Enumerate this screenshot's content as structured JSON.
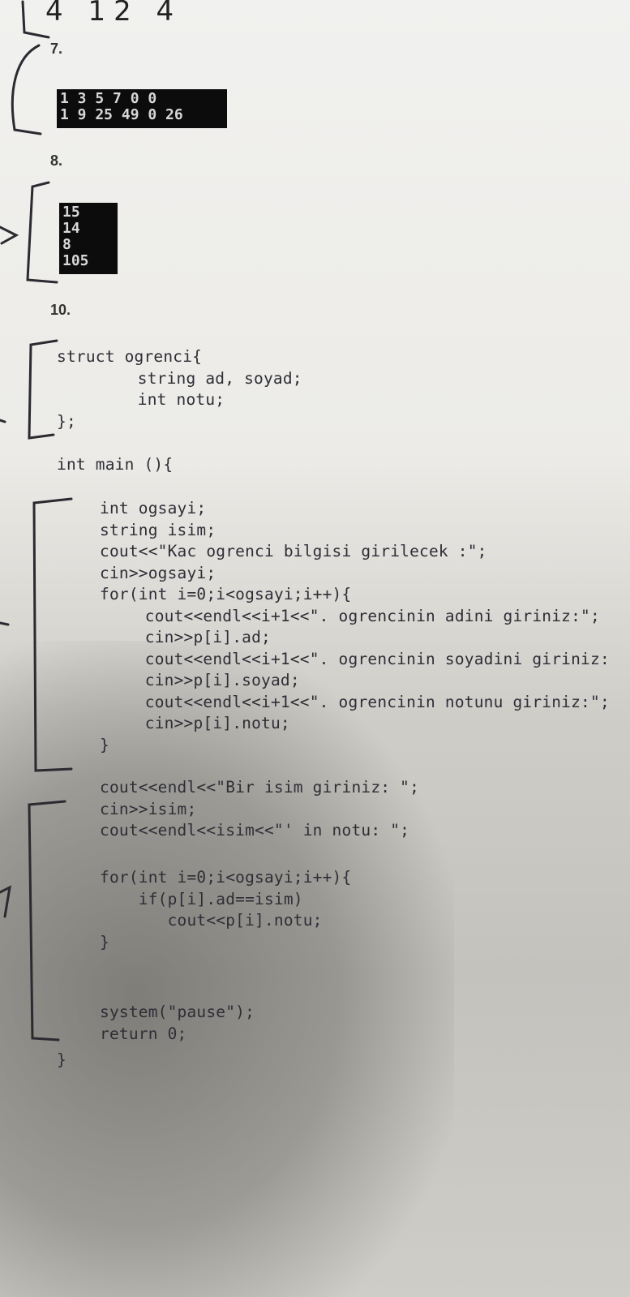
{
  "handwritten_score": "4 12 4",
  "questions": [
    {
      "number": "7.",
      "output_lines": [
        "1 3 5 7 0 0",
        "1 9 25 49 0 26"
      ]
    },
    {
      "number": "8.",
      "output_lines": [
        "15",
        "14",
        "8",
        "105"
      ]
    },
    {
      "number": "10."
    }
  ],
  "code": {
    "struct_lines": [
      "struct ogrenci{",
      "    string ad, soyad;",
      "    int notu;",
      "};"
    ],
    "main_line": "int main (){",
    "block1": [
      "int ogsayi;",
      "string isim;",
      "cout<<\"Kac ogrenci bilgisi girilecek :\";",
      "cin>>ogsayi;",
      "for(int i=0;i<ogsayi;i++){",
      "    cout<<endl<<i+1<<\". ogrencinin adini giriniz:\";",
      "    cin>>p[i].ad;",
      "    cout<<endl<<i+1<<\". ogrencinin soyadini giriniz:",
      "    cin>>p[i].soyad;",
      "    cout<<endl<<i+1<<\". ogrencinin notunu giriniz:\";",
      "    cin>>p[i].notu;",
      "}"
    ],
    "block2": [
      "cout<<endl<<\"Bir isim giriniz: \";",
      "cin>>isim;",
      "cout<<endl<<isim<<\"' in notu: \";"
    ],
    "block3": [
      "for(int i=0;i<ogsayi;i++){",
      "    if(p[i].ad==isim)",
      "       cout<<p[i].notu;",
      "}"
    ],
    "block4": [
      "system(\"pause\");",
      "return 0;"
    ],
    "closing": "}"
  }
}
